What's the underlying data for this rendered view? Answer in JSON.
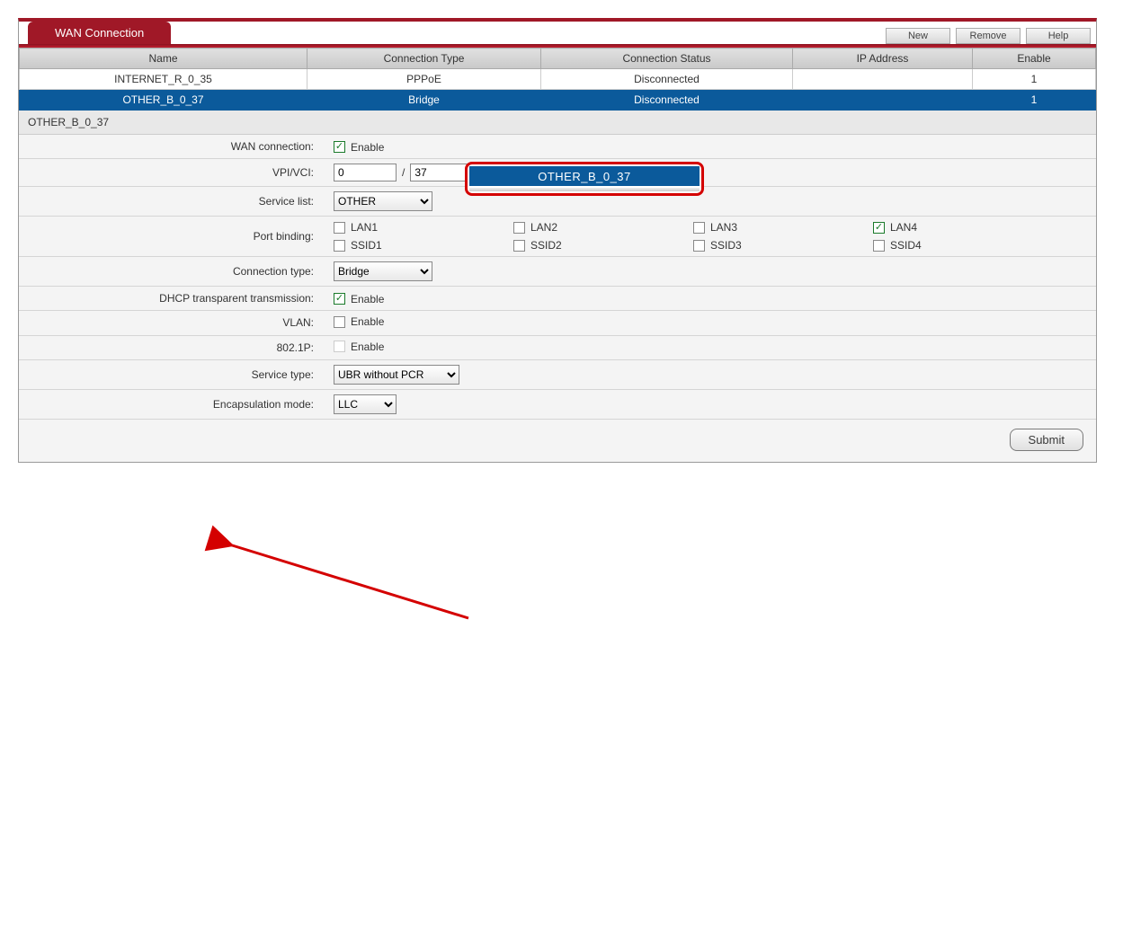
{
  "tab_title": "WAN Connection",
  "buttons": {
    "new": "New",
    "remove": "Remove",
    "help": "Help"
  },
  "columns": {
    "name": "Name",
    "ctype": "Connection Type",
    "status": "Connection Status",
    "ip": "IP Address",
    "enable": "Enable"
  },
  "rows": [
    {
      "name": "INTERNET_R_0_35",
      "ctype": "PPPoE",
      "status": "Disconnected",
      "ip": "",
      "enable": "1",
      "selected": false
    },
    {
      "name": "OTHER_B_0_37",
      "ctype": "Bridge",
      "status": "Disconnected",
      "ip": "",
      "enable": "1",
      "selected": true
    }
  ],
  "section_title": "OTHER_B_0_37",
  "form": {
    "wan_connection_label": "WAN connection:",
    "wan_connection_enable_text": "Enable",
    "wan_connection_checked": true,
    "vpi_vci_label": "VPI/VCI:",
    "vpi": "0",
    "vci": "37",
    "slash": "/",
    "service_list_label": "Service list:",
    "service_list_value": "OTHER",
    "port_binding_label": "Port binding:",
    "ports_row1": [
      {
        "label": "LAN1",
        "checked": false
      },
      {
        "label": "LAN2",
        "checked": false
      },
      {
        "label": "LAN3",
        "checked": false
      },
      {
        "label": "LAN4",
        "checked": true
      }
    ],
    "ports_row2": [
      {
        "label": "SSID1",
        "checked": false
      },
      {
        "label": "SSID2",
        "checked": false
      },
      {
        "label": "SSID3",
        "checked": false
      },
      {
        "label": "SSID4",
        "checked": false
      }
    ],
    "connection_type_label": "Connection type:",
    "connection_type_value": "Bridge",
    "dhcp_label": "DHCP transparent transmission:",
    "dhcp_enable_text": "Enable",
    "dhcp_checked": true,
    "vlan_label": "VLAN:",
    "vlan_enable_text": "Enable",
    "vlan_checked": false,
    "dot1p_label": "802.1P:",
    "dot1p_enable_text": "Enable",
    "dot1p_checked": false,
    "service_type_label": "Service type:",
    "service_type_value": "UBR without PCR",
    "encap_label": "Encapsulation mode:",
    "encap_value": "LLC"
  },
  "callout_text": "OTHER_B_0_37",
  "submit_label": "Submit"
}
